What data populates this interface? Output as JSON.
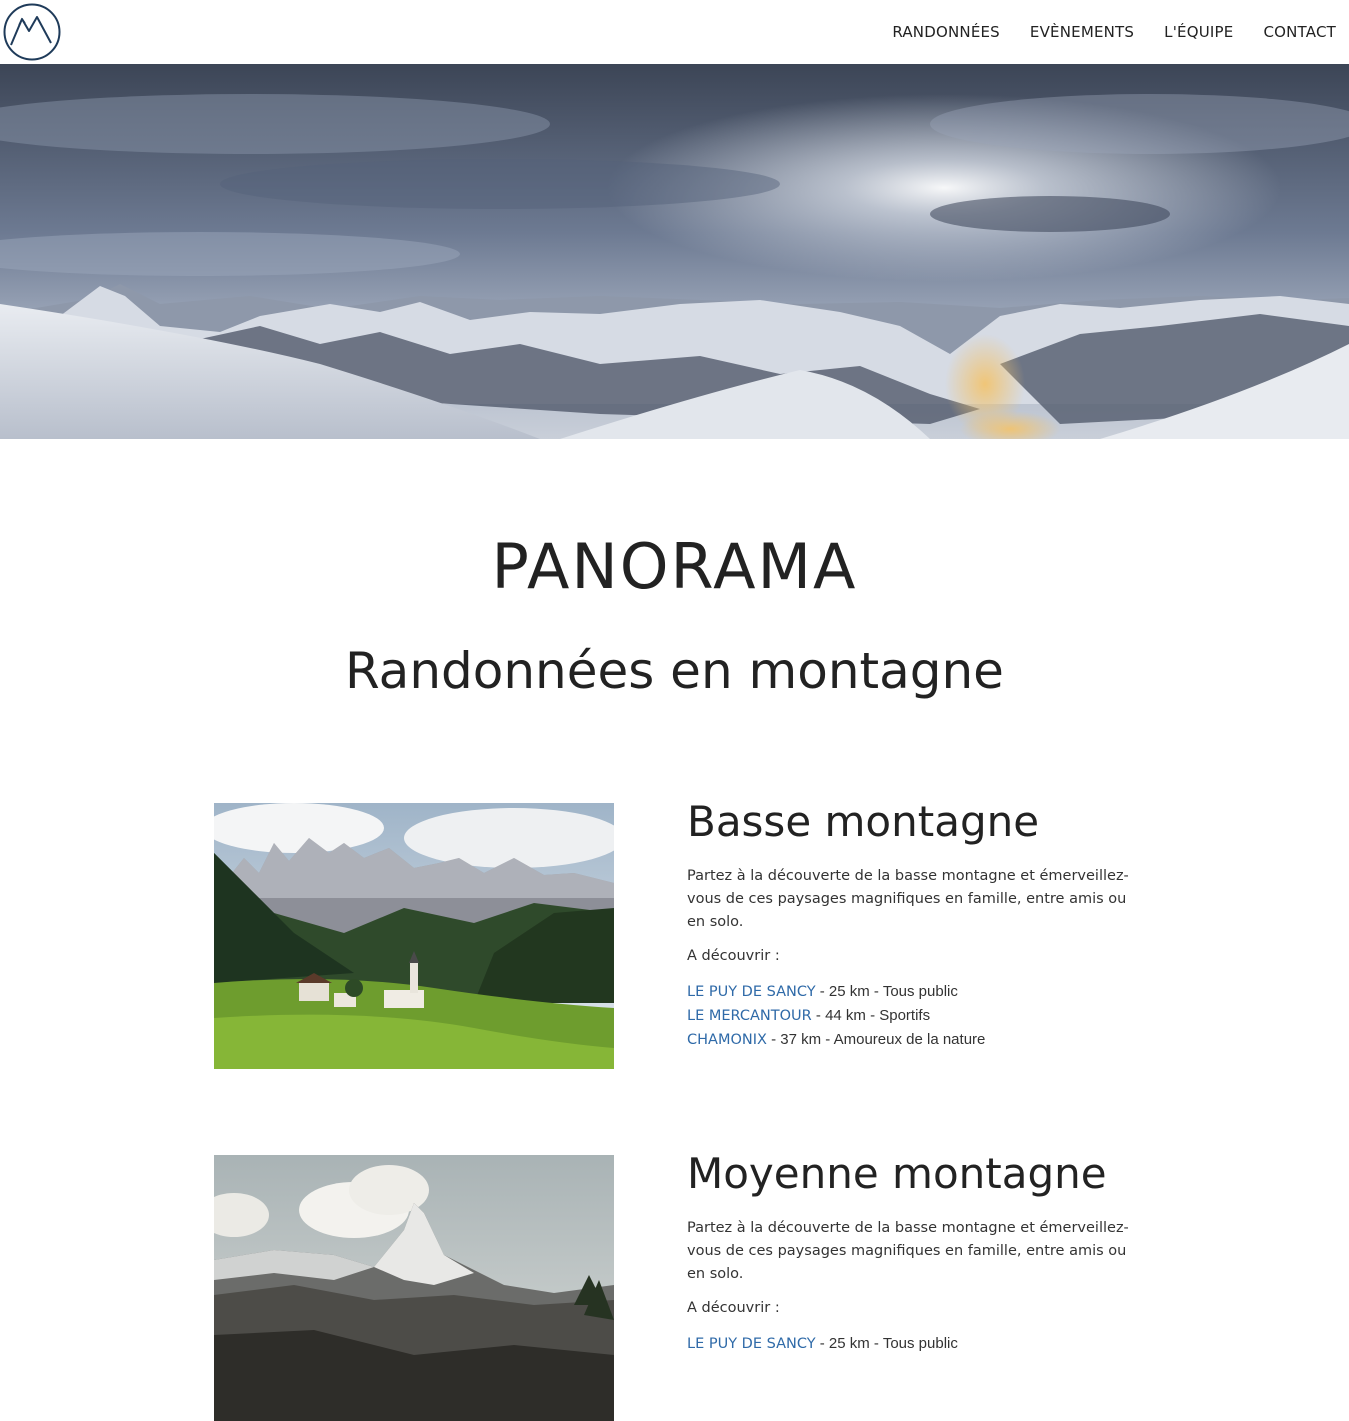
{
  "header": {
    "logo_icon": "mountain-logo-icon",
    "nav": [
      {
        "label": "RANDONNÉES"
      },
      {
        "label": "EVÈNEMENTS"
      },
      {
        "label": "L'ÉQUIPE"
      },
      {
        "label": "CONTACT"
      }
    ]
  },
  "hero": {
    "image": "snowy-mountain-panorama"
  },
  "main": {
    "brand": "PANORAMA",
    "subtitle": "Randonnées en montagne"
  },
  "sections": [
    {
      "title": "Basse montagne",
      "image": "dolomites-village-photo",
      "description": "Partez à la découverte de la basse montagne et émerveillez-vous de ces paysages magnifiques en famille, entre amis ou en solo.",
      "discover_label": "A découvrir :",
      "links": [
        {
          "name": "LE PUY DE SANCY",
          "details": " - 25 km - Tous public"
        },
        {
          "name": "LE MERCANTOUR",
          "details": " - 44 km - Sportifs"
        },
        {
          "name": "CHAMONIX",
          "details": " - 37 km - Amoureux de la nature"
        }
      ]
    },
    {
      "title": "Moyenne montagne",
      "image": "matterhorn-photo",
      "description": "Partez à la découverte de la basse montagne et émerveillez-vous de ces paysages magnifiques en famille, entre amis ou en solo.",
      "discover_label": "A découvrir :",
      "links": [
        {
          "name": "LE PUY DE SANCY",
          "details": " - 25 km - Tous public"
        }
      ]
    }
  ],
  "colors": {
    "link": "#2f6aa8",
    "logo": "#1f3b5a",
    "text": "#222222"
  }
}
